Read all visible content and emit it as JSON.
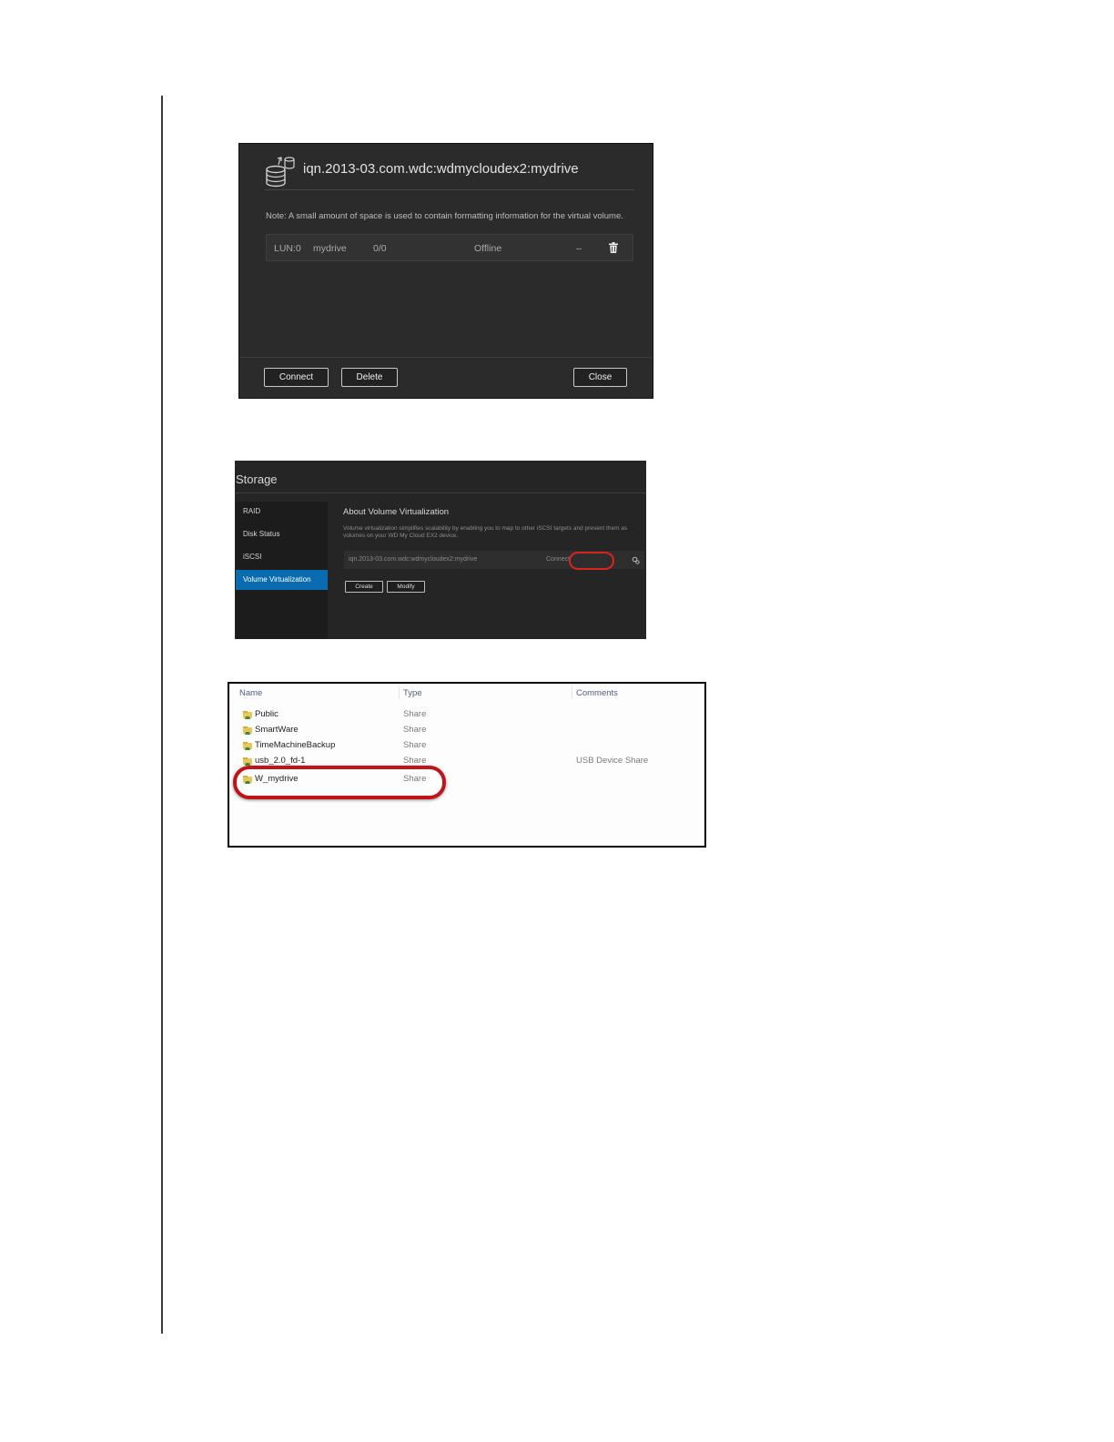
{
  "dialog": {
    "title": "iqn.2013-03.com.wdc:wdmycloudex2:mydrive",
    "note": "Note: A small amount of space is used to contain formatting information for the virtual volume.",
    "lun": {
      "id": "LUN:0",
      "name": "mydrive",
      "ratio": "0/0",
      "status": "Offline",
      "dash": "–"
    },
    "buttons": {
      "connect": "Connect",
      "delete": "Delete",
      "close": "Close"
    },
    "icons": {
      "header": "storage-drive-icon",
      "remove": "trash-icon"
    }
  },
  "storage": {
    "title": "Storage",
    "nav": [
      "RAID",
      "Disk Status",
      "iSCSI",
      "Volume Virtualization"
    ],
    "active_nav": "Volume Virtualization",
    "accent_color": "#0a6cb0",
    "about_title": "About Volume Virtualization",
    "about_desc": "Volume virtualization simplifies scalability by enabling you to map to other iSCSI targets and present them as volumes on your WD My Cloud EX2 device.",
    "target": {
      "name": "iqn.2013-03.com.wdc:wdmycloudex2:mydrive",
      "action": "Connect"
    },
    "buttons": {
      "create": "Create",
      "modify": "Modify"
    },
    "highlight_color": "#d8231f"
  },
  "explorer": {
    "columns": {
      "name": "Name",
      "type": "Type",
      "comments": "Comments"
    },
    "rows": [
      {
        "name": "Public",
        "type": "Share",
        "comment": ""
      },
      {
        "name": "SmartWare",
        "type": "Share",
        "comment": ""
      },
      {
        "name": "TimeMachineBackup",
        "type": "Share",
        "comment": ""
      },
      {
        "name": "usb_2.0_fd-1",
        "type": "Share",
        "comment": "USB Device Share"
      },
      {
        "name": "W_mydrive",
        "type": "Share",
        "comment": ""
      }
    ],
    "highlighted_row": "W_mydrive",
    "highlight_color": "#c0141a"
  }
}
